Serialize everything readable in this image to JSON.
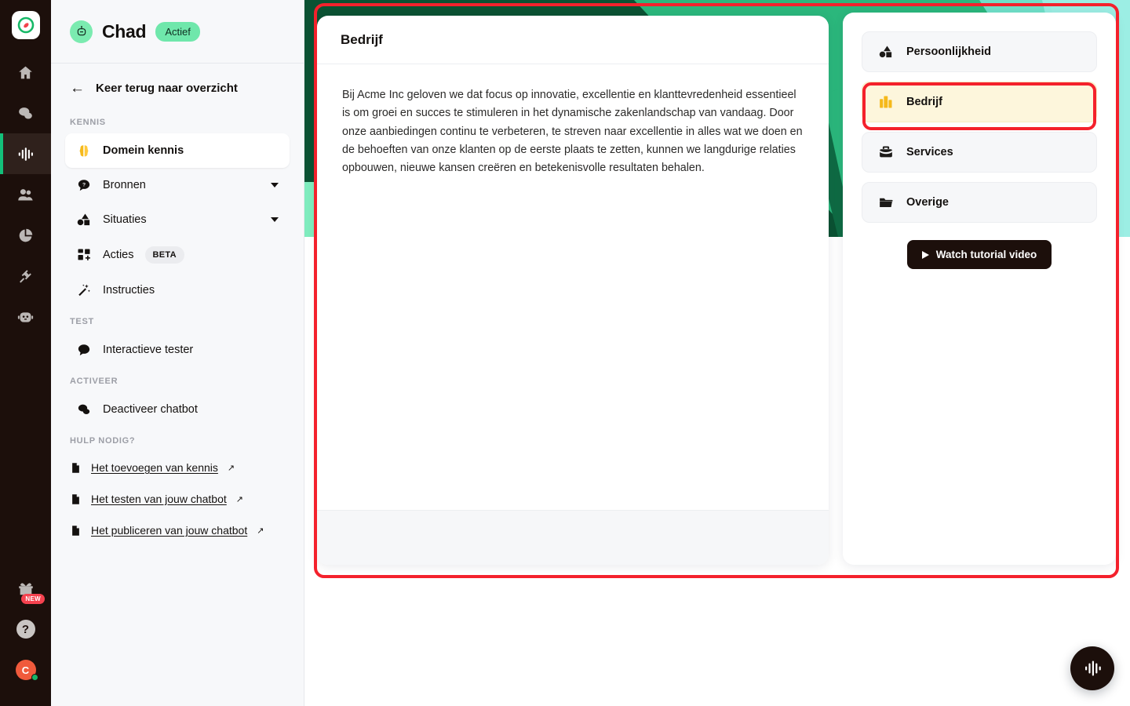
{
  "rail": {
    "logo_icon": "compass-logo-icon",
    "items": [
      {
        "icon": "home-icon",
        "name": "rail-item-home",
        "active": false
      },
      {
        "icon": "chat-bubbles-icon",
        "name": "rail-item-conversations",
        "active": false
      },
      {
        "icon": "waveform-icon",
        "name": "rail-item-chatbots",
        "active": true
      },
      {
        "icon": "users-icon",
        "name": "rail-item-contacts",
        "active": false
      },
      {
        "icon": "pie-chart-icon",
        "name": "rail-item-analytics",
        "active": false
      },
      {
        "icon": "plug-icon",
        "name": "rail-item-integrations",
        "active": false
      },
      {
        "icon": "robot-icon",
        "name": "rail-item-bots",
        "active": false
      }
    ],
    "gift_icon": "gift-icon",
    "gift_badge": "NEW",
    "help_icon": "question-mark-icon",
    "help_label": "?",
    "avatar_initial": "C",
    "avatar_status": "online"
  },
  "sidebar": {
    "bot_avatar_icon": "robot-head-icon",
    "bot_name": "Chad",
    "status_label": "Actief",
    "back_label": "Keer terug naar overzicht",
    "back_icon": "arrow-left-icon",
    "sections": [
      {
        "label": "KENNIS",
        "items": [
          {
            "label": "Domein kennis",
            "icon": "brain-icon",
            "active": true,
            "caret": false,
            "badge": null
          },
          {
            "label": "Bronnen",
            "icon": "question-bubble-icon",
            "active": false,
            "caret": true,
            "badge": null
          },
          {
            "label": "Situaties",
            "icon": "shapes-icon",
            "active": false,
            "caret": true,
            "badge": null
          },
          {
            "label": "Acties",
            "icon": "grid-plus-icon",
            "active": false,
            "caret": false,
            "badge": "BETA"
          },
          {
            "label": "Instructies",
            "icon": "magic-wand-icon",
            "active": false,
            "caret": false,
            "badge": null
          }
        ]
      },
      {
        "label": "TEST",
        "items": [
          {
            "label": "Interactieve tester",
            "icon": "chat-dots-icon",
            "active": false,
            "caret": false,
            "badge": null
          }
        ]
      },
      {
        "label": "ACTIVEER",
        "items": [
          {
            "label": "Deactiveer chatbot",
            "icon": "chat-bubbles-icon",
            "active": false,
            "caret": false,
            "badge": null
          }
        ]
      }
    ],
    "help_section_label": "HULP NODIG?",
    "help_links": [
      {
        "label": "Het toevoegen van kennis",
        "icon": "document-icon",
        "external": "↗"
      },
      {
        "label": "Het testen van jouw chatbot",
        "icon": "document-icon",
        "external": "↗"
      },
      {
        "label": "Het publiceren van jouw chatbot",
        "icon": "document-icon",
        "external": "↗"
      }
    ]
  },
  "main_card": {
    "title": "Bedrijf",
    "body_text": "Bij Acme Inc geloven we dat focus op innovatie, excellentie en klanttevredenheid essentieel is om groei en succes te stimuleren in het dynamische zakenlandschap van vandaag. Door onze aanbiedingen continu te verbeteren, te streven naar excellentie in alles wat we doen en de behoeften van onze klanten op de eerste plaats te zetten, kunnen we langdurige relaties opbouwen, nieuwe kansen creëren en betekenisvolle resultaten behalen."
  },
  "right_panel": {
    "categories": [
      {
        "label": "Persoonlijkheid",
        "icon": "shapes-icon",
        "selected": false
      },
      {
        "label": "Bedrijf",
        "icon": "buildings-icon",
        "selected": true
      },
      {
        "label": "Services",
        "icon": "briefcase-icon",
        "selected": false
      },
      {
        "label": "Overige",
        "icon": "folder-icon",
        "selected": false
      }
    ],
    "tutorial_button": "Watch tutorial video",
    "tutorial_icon": "play-icon"
  },
  "fab": {
    "icon": "waveform-icon"
  },
  "colors": {
    "rail_bg": "#1c0f0b",
    "accent_green": "#13c07a",
    "status_green": "#6fe7ab",
    "annotation_red": "#f4212c",
    "selected_yellow": "#fdf6dc",
    "icon_amber": "#f5b91b",
    "backdrop_dark_green": "#0b5233",
    "backdrop_mid_green": "#2bb77c",
    "backdrop_cyan": "#97eee2",
    "backdrop_mint": "#7fecbe"
  }
}
